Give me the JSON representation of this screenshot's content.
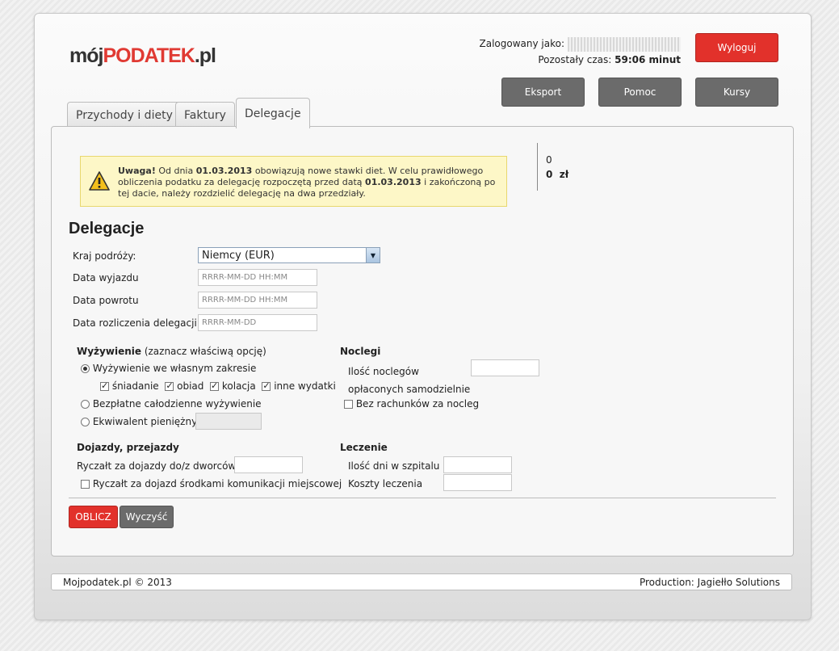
{
  "header": {
    "logo": {
      "part1": "mój",
      "part2": "PODATEK",
      "part3": ".pl"
    },
    "logged_as_label": "Zalogowany jako:",
    "time_label": "Pozostały czas:",
    "time_value": "59:06 minut",
    "logout": "Wyloguj",
    "buttons": [
      "Eksport",
      "Pomoc",
      "Kursy"
    ]
  },
  "tabs": [
    {
      "label": "Przychody i diety",
      "active": false
    },
    {
      "label": "Faktury",
      "active": false
    },
    {
      "label": "Delegacje",
      "active": true
    }
  ],
  "warning": {
    "icon": "warning-icon",
    "bold_start": "Uwaga!",
    "t1": " Od dnia ",
    "date1": "01.03.2013",
    "t2": " obowiązują nowe stawki diet. W celu prawidłowego obliczenia podatku za delegację rozpoczętą przed datą ",
    "date2": "01.03.2013",
    "t3": " i zakończoną po tej dacie, należy rozdzielić delegację na dwa przedziały."
  },
  "summary": {
    "line1": "0",
    "amount": "0",
    "currency": "zł"
  },
  "form": {
    "title": "Delegacje",
    "country_label": "Kraj podróży:",
    "country_value": "Niemcy (EUR)",
    "departure_label": "Data wyjazdu",
    "departure_placeholder": "RRRR-MM-DD HH:MM",
    "return_label": "Data powrotu",
    "return_placeholder": "RRRR-MM-DD HH:MM",
    "settlement_label": "Data rozliczenia delegacji",
    "settlement_placeholder": "RRRR-MM-DD"
  },
  "meals": {
    "title": "Wyżywienie",
    "hint": " (zaznacz właściwą opcję)",
    "opt_own": "Wyżywienie we własnym zakresie",
    "breakfast": "śniadanie",
    "lunch": "obiad",
    "dinner": "kolacja",
    "other": "inne wydatki",
    "opt_free": "Bezpłatne całodzienne wyżywienie",
    "opt_cash": "Ekwiwalent pieniężny"
  },
  "lodging": {
    "title": "Noclegi",
    "nights_label_1": "Ilość noclegów",
    "nights_label_2": "opłaconych samodzielnie",
    "no_receipts": "Bez rachunków za nocleg"
  },
  "commute": {
    "title": "Dojazdy, przejazdy",
    "lump_station": "Ryczałt za dojazdy do/z dworców",
    "lump_local": "Ryczałt za dojazd środkami komunikacji miejscowej"
  },
  "treatment": {
    "title": "Leczenie",
    "days_label": "Ilość dni w szpitalu",
    "cost_label": "Koszty leczenia"
  },
  "actions": {
    "calculate": "OBLICZ",
    "clear": "Wyczyść"
  },
  "footer": {
    "left": "Mojpodatek.pl © 2013",
    "right": "Production: Jagiełło Solutions"
  }
}
